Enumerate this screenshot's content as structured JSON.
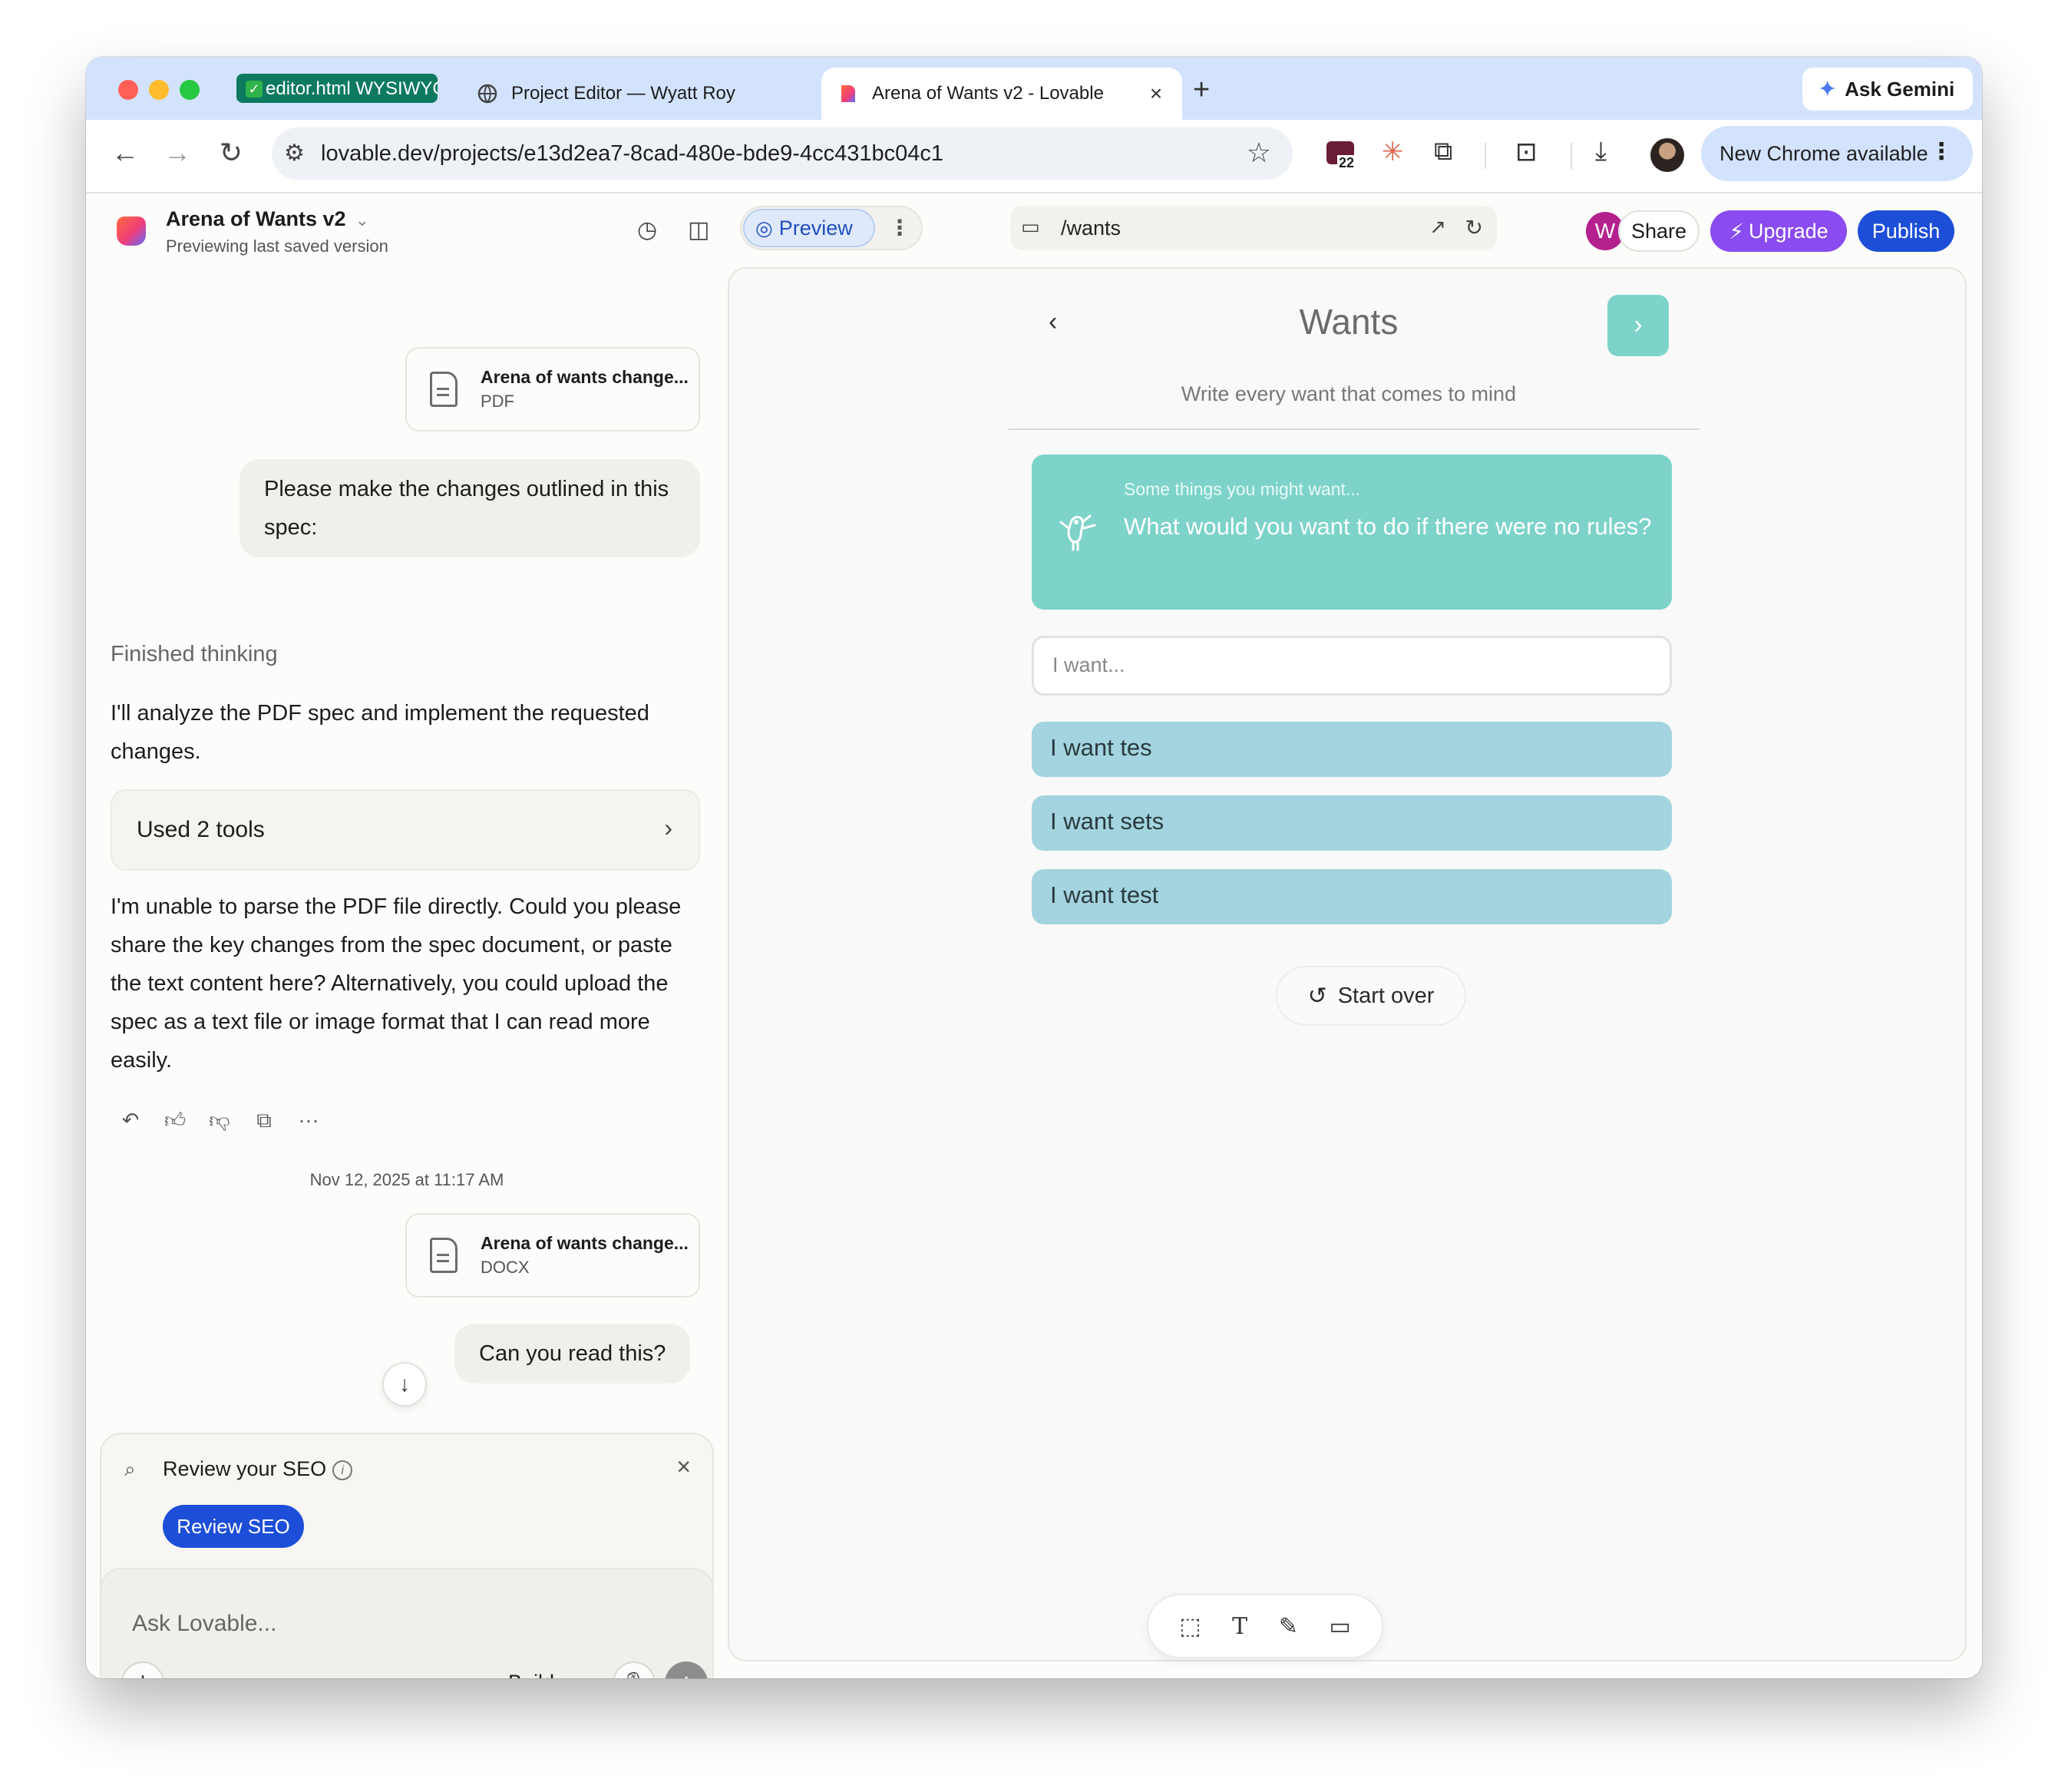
{
  "browser": {
    "tabs": [
      {
        "label": "editor.html WYSIWYG",
        "pinned": true
      },
      {
        "label": "Project Editor — Wyatt Roy"
      },
      {
        "label": "Arena of Wants v2 - Lovable",
        "active": true
      }
    ],
    "url_host": "lovable.dev",
    "url_path": "/projects/e13d2ea7-8cad-480e-bde9-4cc431bc04c1",
    "ask_gemini": "Ask Gemini",
    "extension_badge": "22",
    "chrome_update": "New Chrome available"
  },
  "app": {
    "project_title": "Arena of Wants v2",
    "project_subtitle": "Previewing last saved version",
    "preview_label": "Preview",
    "route": "/wants",
    "avatar_initial": "W",
    "share": "Share",
    "upgrade": "Upgrade",
    "publish": "Publish"
  },
  "chat": {
    "file1": {
      "name": "Arena of wants change...",
      "type": "PDF"
    },
    "user_msg1": "Please make the changes outlined in this spec:",
    "thinking": "Finished thinking",
    "assistant_msg1": "I'll analyze the PDF spec and implement the requested changes.",
    "tools": "Used 2 tools",
    "assistant_msg2": "I'm unable to parse the PDF file directly. Could you please share the key changes from the spec document, or paste the text content here? Alternatively, you could upload the spec as a text file or image format that I can read more easily.",
    "timestamp": "Nov 12, 2025 at 11:17 AM",
    "file2": {
      "name": "Arena of wants change...",
      "type": "DOCX"
    },
    "user_msg2": "Can you read this?",
    "seo_title": "Review your SEO",
    "seo_button": "Review SEO",
    "composer_placeholder": "Ask Lovable...",
    "mode": "Build"
  },
  "preview": {
    "title": "Wants",
    "subtitle": "Write every want that comes to mind",
    "hint": "Some things you might want...",
    "question": "What would you want to do if there were no rules?",
    "input_placeholder": "I want...",
    "wants": [
      "I want tes",
      "I want sets",
      "I want test"
    ],
    "start_over": "Start over"
  },
  "colors": {
    "accent_blue": "#1d4ed8",
    "upgrade_purple": "#8a4bf0",
    "teal_card": "#7dd3c9",
    "want_row": "#a3d4df"
  }
}
